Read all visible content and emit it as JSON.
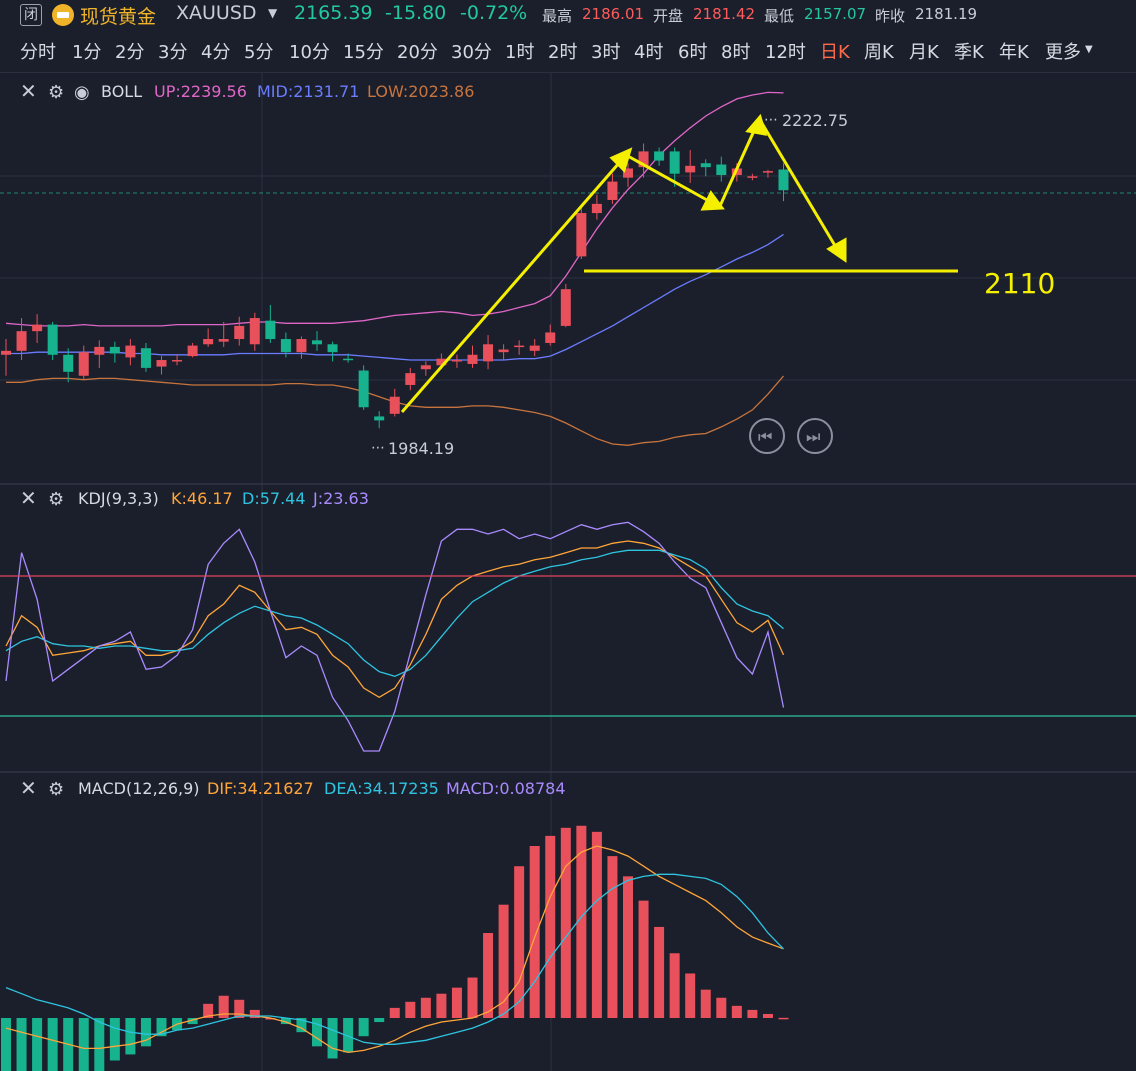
{
  "header": {
    "closed_badge": "闭",
    "symbol_name": "现货黄金",
    "symbol_code": "XAUUSD",
    "last_price": "2165.39",
    "change": "-15.80",
    "change_pct": "-0.72%",
    "stats": [
      {
        "label": "最高",
        "value": "2186.01",
        "color": "#ff5b5b"
      },
      {
        "label": "开盘",
        "value": "2181.42",
        "color": "#ff5b5b"
      },
      {
        "label": "最低",
        "value": "2157.07",
        "color": "#22c9a0"
      },
      {
        "label": "昨收",
        "value": "2181.19",
        "color": "#c8ccd6"
      }
    ]
  },
  "tabs": [
    "分时",
    "1分",
    "2分",
    "3分",
    "4分",
    "5分",
    "10分",
    "15分",
    "20分",
    "30分",
    "1时",
    "2时",
    "3时",
    "4时",
    "6时",
    "8时",
    "12时",
    "日K",
    "周K",
    "月K",
    "季K",
    "年K",
    "更多"
  ],
  "active_tab": "日K",
  "panels": {
    "boll": {
      "name": "BOLL",
      "up": "UP:2239.56",
      "mid": "MID:2131.71",
      "low": "LOW:2023.86",
      "colors": {
        "up": "#e066c8",
        "mid": "#6a7cff",
        "low": "#c7743e"
      }
    },
    "kdj": {
      "name": "KDJ(9,3,3)",
      "k": "K:46.17",
      "d": "D:57.44",
      "j": "J:23.63",
      "colors": {
        "k": "#ffa53a",
        "d": "#2ec4e0",
        "j": "#a98bff"
      }
    },
    "macd": {
      "name": "MACD(12,26,9)",
      "dif": "DIF:34.21627",
      "dea": "DEA:34.17235",
      "macd": "MACD:0.08784",
      "colors": {
        "dif": "#ffa53a",
        "dea": "#2ec4e0",
        "macd": "#a98bff"
      }
    }
  },
  "annotations": {
    "high_label": "2222.75",
    "low_label": "1984.19",
    "target_label": "2110"
  },
  "chart_data": {
    "type": "candlestick",
    "price_axis": [
      1984.19,
      2222.75
    ],
    "candles": [
      {
        "o": 2040,
        "c": 2043,
        "h": 2052,
        "l": 2024
      },
      {
        "o": 2043,
        "c": 2058,
        "h": 2068,
        "l": 2036
      },
      {
        "o": 2058,
        "c": 2063,
        "h": 2071,
        "l": 2049
      },
      {
        "o": 2063,
        "c": 2040,
        "h": 2065,
        "l": 2036
      },
      {
        "o": 2040,
        "c": 2027,
        "h": 2045,
        "l": 2019
      },
      {
        "o": 2024,
        "c": 2042,
        "h": 2047,
        "l": 2021
      },
      {
        "o": 2040,
        "c": 2046,
        "h": 2051,
        "l": 2030
      },
      {
        "o": 2046,
        "c": 2041,
        "h": 2050,
        "l": 2034
      },
      {
        "o": 2038,
        "c": 2047,
        "h": 2052,
        "l": 2032
      },
      {
        "o": 2045,
        "c": 2030,
        "h": 2049,
        "l": 2027
      },
      {
        "o": 2031,
        "c": 2036,
        "h": 2039,
        "l": 2025
      },
      {
        "o": 2036,
        "c": 2036,
        "h": 2040,
        "l": 2032
      },
      {
        "o": 2039,
        "c": 2047,
        "h": 2049,
        "l": 2038
      },
      {
        "o": 2048,
        "c": 2052,
        "h": 2060,
        "l": 2046
      },
      {
        "o": 2050,
        "c": 2052,
        "h": 2065,
        "l": 2046
      },
      {
        "o": 2052,
        "c": 2062,
        "h": 2069,
        "l": 2047
      },
      {
        "o": 2048,
        "c": 2068,
        "h": 2072,
        "l": 2043
      },
      {
        "o": 2066,
        "c": 2052,
        "h": 2078,
        "l": 2049
      },
      {
        "o": 2052,
        "c": 2042,
        "h": 2057,
        "l": 2038
      },
      {
        "o": 2042,
        "c": 2052,
        "h": 2054,
        "l": 2037
      },
      {
        "o": 2051,
        "c": 2048,
        "h": 2058,
        "l": 2043
      },
      {
        "o": 2048,
        "c": 2042,
        "h": 2050,
        "l": 2035
      },
      {
        "o": 2037,
        "c": 2036,
        "h": 2041,
        "l": 2034
      },
      {
        "o": 2028,
        "c": 2000,
        "h": 2032,
        "l": 1998
      },
      {
        "o": 1993,
        "c": 1990,
        "h": 1997,
        "l": 1984
      },
      {
        "o": 1995,
        "c": 2008,
        "h": 2014,
        "l": 1993
      },
      {
        "o": 2017,
        "c": 2026,
        "h": 2030,
        "l": 2013
      },
      {
        "o": 2029,
        "c": 2032,
        "h": 2035,
        "l": 2024
      },
      {
        "o": 2032,
        "c": 2037,
        "h": 2041,
        "l": 2029
      },
      {
        "o": 2036,
        "c": 2036,
        "h": 2040,
        "l": 2030
      },
      {
        "o": 2033,
        "c": 2040,
        "h": 2047,
        "l": 2030
      },
      {
        "o": 2035,
        "c": 2048,
        "h": 2055,
        "l": 2029
      },
      {
        "o": 2042,
        "c": 2044,
        "h": 2048,
        "l": 2036
      },
      {
        "o": 2046,
        "c": 2047,
        "h": 2051,
        "l": 2040
      },
      {
        "o": 2043,
        "c": 2047,
        "h": 2052,
        "l": 2039
      },
      {
        "o": 2049,
        "c": 2057,
        "h": 2063,
        "l": 2047
      },
      {
        "o": 2062,
        "c": 2090,
        "h": 2094,
        "l": 2061
      },
      {
        "o": 2115,
        "c": 2148,
        "h": 2153,
        "l": 2113
      },
      {
        "o": 2148,
        "c": 2155,
        "h": 2162,
        "l": 2143
      },
      {
        "o": 2158,
        "c": 2172,
        "h": 2178,
        "l": 2155
      },
      {
        "o": 2175,
        "c": 2182,
        "h": 2186,
        "l": 2168
      },
      {
        "o": 2183,
        "c": 2195,
        "h": 2201,
        "l": 2175
      },
      {
        "o": 2195,
        "c": 2188,
        "h": 2198,
        "l": 2184
      },
      {
        "o": 2195,
        "c": 2178,
        "h": 2198,
        "l": 2168
      },
      {
        "o": 2179,
        "c": 2184,
        "h": 2196,
        "l": 2171
      },
      {
        "o": 2186,
        "c": 2183,
        "h": 2189,
        "l": 2176
      },
      {
        "o": 2185,
        "c": 2177,
        "h": 2191,
        "l": 2172
      },
      {
        "o": 2177,
        "c": 2182,
        "h": 2186,
        "l": 2172
      },
      {
        "o": 2176,
        "c": 2176,
        "h": 2178,
        "l": 2173
      },
      {
        "o": 2180,
        "c": 2180,
        "h": 2181,
        "l": 2175
      },
      {
        "o": 2181.19,
        "c": 2165.39,
        "h": 2186.01,
        "l": 2157.07
      }
    ],
    "boll_up": [
      2064,
      2063,
      2062,
      2062,
      2062,
      2063,
      2062,
      2062,
      2062,
      2062,
      2062,
      2063,
      2063,
      2063,
      2063,
      2064,
      2065,
      2065,
      2064,
      2064,
      2064,
      2064,
      2065,
      2066,
      2068,
      2070,
      2071,
      2072,
      2073,
      2072,
      2070,
      2071,
      2073,
      2076,
      2079,
      2085,
      2100,
      2118,
      2136,
      2152,
      2166,
      2178,
      2192,
      2203,
      2213,
      2222,
      2229,
      2235,
      2238,
      2240,
      2239.56
    ],
    "boll_mid": [
      2041,
      2041,
      2042,
      2042,
      2042,
      2042,
      2042,
      2042,
      2041,
      2041,
      2040,
      2040,
      2040,
      2040,
      2040,
      2041,
      2041,
      2041,
      2041,
      2041,
      2040,
      2040,
      2040,
      2039,
      2038,
      2037,
      2036,
      2036,
      2036,
      2036,
      2036,
      2036,
      2036,
      2037,
      2037,
      2039,
      2044,
      2050,
      2056,
      2062,
      2069,
      2076,
      2083,
      2090,
      2096,
      2101,
      2107,
      2113,
      2118,
      2124,
      2131.71
    ],
    "boll_low": [
      2019,
      2019,
      2021,
      2022,
      2022,
      2021,
      2022,
      2022,
      2021,
      2020,
      2019,
      2018,
      2017,
      2017,
      2017,
      2017,
      2017,
      2017,
      2018,
      2018,
      2017,
      2017,
      2015,
      2012,
      2008,
      2004,
      2001,
      2000,
      2000,
      2000,
      2001,
      2001,
      2000,
      1998,
      1996,
      1993,
      1988,
      1982,
      1976,
      1972,
      1971,
      1973,
      1974,
      1977,
      1979,
      1980,
      1985,
      1991,
      1998,
      2010,
      2023.86
    ],
    "kdj_k": [
      50,
      63,
      58,
      46,
      47,
      48,
      50,
      51,
      52,
      46,
      46,
      48,
      52,
      63,
      68,
      76,
      73,
      65,
      57,
      58,
      55,
      46,
      41,
      32,
      28,
      32,
      42,
      55,
      70,
      76,
      80,
      82,
      84,
      85,
      87,
      88,
      90,
      92,
      92,
      94,
      95,
      94,
      92,
      88,
      84,
      80,
      70,
      60,
      56,
      61,
      46.17
    ],
    "kdj_d": [
      48,
      52,
      54,
      51,
      50,
      50,
      49,
      50,
      50,
      49,
      48,
      48,
      49,
      55,
      60,
      64,
      67,
      65,
      63,
      62,
      59,
      55,
      51,
      44,
      39,
      37,
      40,
      46,
      54,
      62,
      69,
      73,
      77,
      80,
      82,
      84,
      85,
      87,
      88,
      90,
      91,
      91,
      91,
      89,
      87,
      83,
      75,
      68,
      65,
      63,
      57.44
    ],
    "kdj_j": [
      35,
      90,
      70,
      35,
      40,
      45,
      50,
      52,
      56,
      40,
      41,
      46,
      57,
      85,
      94,
      100,
      86,
      65,
      45,
      50,
      46,
      28,
      18,
      5,
      5,
      22,
      47,
      72,
      95,
      100,
      100,
      98,
      100,
      96,
      98,
      96,
      99,
      102,
      100,
      102,
      103,
      99,
      94,
      86,
      79,
      75,
      60,
      45,
      38,
      56,
      23.63
    ],
    "dif": [
      -5,
      -7,
      -9,
      -11,
      -13,
      -15,
      -15,
      -14,
      -13,
      -11,
      -7,
      -3,
      -1,
      1,
      2,
      2,
      1,
      0,
      -2,
      -5,
      -10,
      -15,
      -17,
      -16,
      -14,
      -11,
      -7,
      -4,
      -2,
      -1,
      0,
      3,
      8,
      18,
      40,
      60,
      75,
      82,
      85,
      83,
      80,
      75,
      70,
      66,
      62,
      58,
      52,
      45,
      40,
      37,
      34.21627
    ],
    "dea": [
      15,
      12,
      9,
      7,
      5,
      2,
      -2,
      -5,
      -7,
      -8,
      -8,
      -6,
      -5,
      -3,
      -1,
      1,
      1,
      1,
      0,
      -1,
      -3,
      -6,
      -9,
      -12,
      -13,
      -13,
      -12,
      -11,
      -9,
      -7,
      -5,
      -2,
      2,
      8,
      18,
      30,
      40,
      50,
      58,
      64,
      68,
      70,
      71,
      71,
      70,
      69,
      66,
      60,
      52,
      42,
      34.17235
    ],
    "macd": [
      -40,
      -38,
      -36,
      -35,
      -33,
      -33,
      -27,
      -21,
      -18,
      -14,
      -9,
      -6,
      -3,
      7,
      11,
      9,
      4,
      0,
      -3,
      -7,
      -14,
      -20,
      -17,
      -9,
      -2,
      5,
      8,
      10,
      12,
      15,
      20,
      42,
      56,
      75,
      85,
      90,
      94,
      95,
      92,
      80,
      70,
      58,
      45,
      32,
      22,
      14,
      10,
      6,
      4,
      2,
      0.08784
    ],
    "kdj_levels": [
      80,
      20
    ]
  }
}
